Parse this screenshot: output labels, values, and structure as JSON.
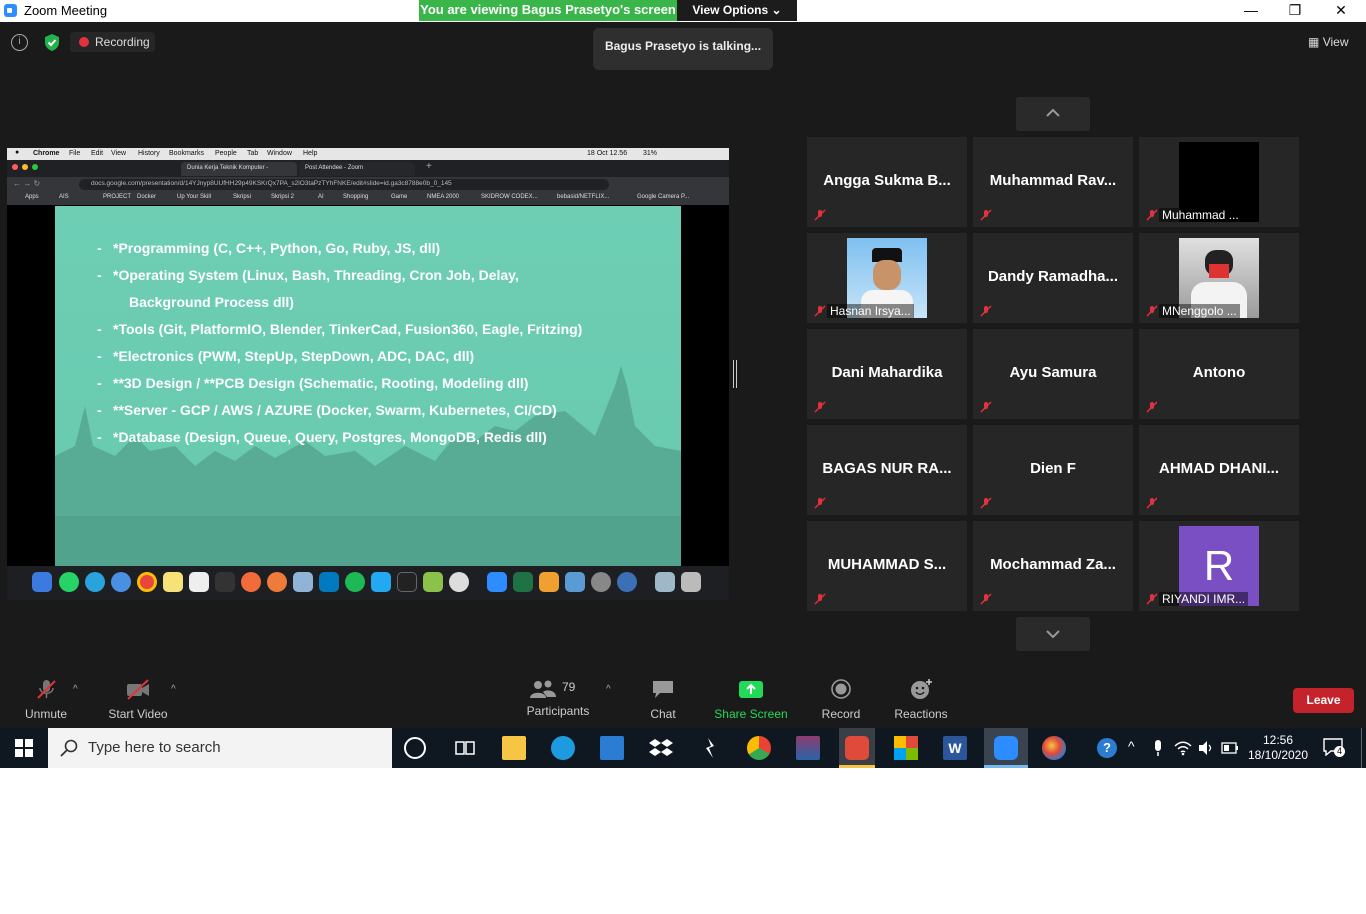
{
  "window": {
    "title": "Zoom Meeting"
  },
  "banner": {
    "viewing": "You are viewing Bagus Prasetyo's screen",
    "view_options": "View Options"
  },
  "topbar": {
    "recording": "Recording",
    "view": "View"
  },
  "talking": "Bagus Prasetyo is talking...",
  "shared": {
    "mac_menu": [
      "Chrome",
      "File",
      "Edit",
      "View",
      "History",
      "Bookmarks",
      "People",
      "Tab",
      "Window",
      "Help"
    ],
    "mac_status": "18 Oct 12.56",
    "battery": "31%",
    "tabs": [
      "Dunia Kerja Teknik Komputer -",
      "Post Attendee - Zoom"
    ],
    "url": "docs.google.com/presentation/d/14YJnyp8UUfHH29p49KSKrQx7PA_s2lO3taPzTYhFNKE/edit#slide=id.ga3c8788e0b_0_145",
    "bookmarks": [
      "Apps",
      "AIS",
      "PROJECT",
      "Docker",
      "Up Your Skill",
      "Skripsi",
      "Skripsi 2",
      "AI",
      "Shopping",
      "Game",
      "NMEA 2000",
      "SKIDROW CODEX...",
      "bebasid/NETFLIX...",
      "Google Camera P..."
    ],
    "slide_lines": [
      "*Programming (C, C++, Python, Go, Ruby, JS, dll)",
      "*Operating System (Linux, Bash, Threading, Cron Job, Delay,",
      "Background Process dll)",
      "*Tools (Git, PlatformIO, Blender, TinkerCad, Fusion360, Eagle, Fritzing)",
      "*Electronics (PWM, StepUp, StepDown, ADC, DAC, dll)",
      "**3D Design / **PCB Design (Schematic, Rooting, Modeling dll)",
      "**Server - GCP / AWS / AZURE (Docker, Swarm, Kubernetes, CI/CD)",
      "*Database (Design, Queue, Query, Postgres, MongoDB, Redis dll)"
    ]
  },
  "participants": [
    {
      "name": "Angga Sukma B..."
    },
    {
      "name": "Muhammad Rav..."
    },
    {
      "name": "Muhammad ...",
      "label": true,
      "video": "black"
    },
    {
      "name": "Hasnan Irsya...",
      "label": true,
      "video": "photo1"
    },
    {
      "name": "Dandy Ramadha..."
    },
    {
      "name": "MNenggolo ...",
      "label": true,
      "video": "photo2"
    },
    {
      "name": "Dani Mahardika"
    },
    {
      "name": "Ayu Samura"
    },
    {
      "name": "Antono"
    },
    {
      "name": "BAGAS NUR RA..."
    },
    {
      "name": "Dien F"
    },
    {
      "name": "AHMAD DHANI..."
    },
    {
      "name": "MUHAMMAD S..."
    },
    {
      "name": "Mochammad Za..."
    },
    {
      "name": "RIYANDI IMR...",
      "label": true,
      "video": "avatar",
      "initial": "R"
    }
  ],
  "toolbar": {
    "unmute": "Unmute",
    "start_video": "Start Video",
    "participants": "Participants",
    "participants_count": "79",
    "chat": "Chat",
    "share_screen": "Share Screen",
    "record": "Record",
    "reactions": "Reactions",
    "leave": "Leave"
  },
  "taskbar": {
    "search_placeholder": "Type here to search",
    "time": "12:56",
    "date": "18/10/2020",
    "notifications": "4"
  },
  "colors": {
    "banner": "#3ab54a",
    "leave": "#c4232b",
    "share": "#23d959",
    "avatar": "#7b4fc4",
    "slide": "#67c9ae"
  }
}
